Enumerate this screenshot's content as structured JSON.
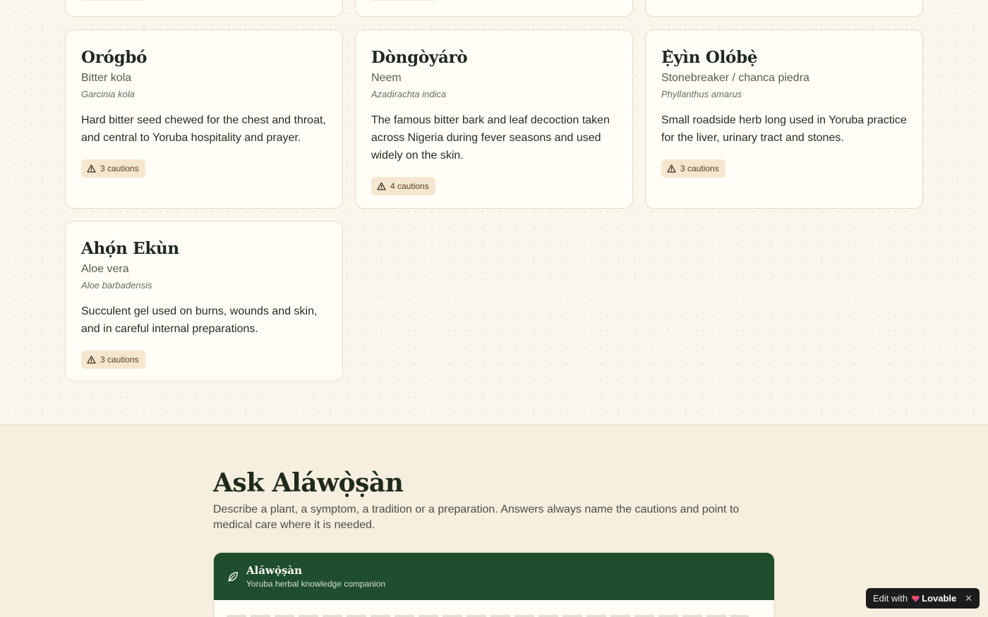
{
  "herbs": [
    {
      "name": "Orógbó",
      "common": "Bitter kola",
      "latin": "Garcinia kola",
      "description": "Hard bitter seed chewed for the chest and throat, and central to Yoruba hospitality and prayer.",
      "cautions": "3 cautions"
    },
    {
      "name": "Dòngòyárò",
      "common": "Neem",
      "latin": "Azadirachta indica",
      "description": "The famous bitter bark and leaf decoction taken across Nigeria during fever seasons and used widely on the skin.",
      "cautions": "4 cautions"
    },
    {
      "name": "Ẹ̀yìn Olóbẹ̀",
      "common": "Stonebreaker / chanca piedra",
      "latin": "Phyllanthus amarus",
      "description": "Small roadside herb long used in Yoruba practice for the liver, urinary tract and stones.",
      "cautions": "3 cautions"
    },
    {
      "name": "Ahọ́n Ekùn",
      "common": "Aloe vera",
      "latin": "Aloe barbadensis",
      "description": "Succulent gel used on burns, wounds and skin, and in careful internal preparations.",
      "cautions": "3 cautions"
    }
  ],
  "ask": {
    "title": "Ask Aláwọ̀ṣàn",
    "subtitle": "Describe a plant, a symptom, a tradition or a preparation. Answers always name the cautions and point to medical care where it is needed."
  },
  "chat": {
    "title": "Aláwọ̀ṣàn",
    "subtitle": "Yoruba herbal knowledge companion",
    "icon": "leaf-icon",
    "header_color": "#1f4d2e"
  },
  "edit_badge": {
    "label": "Edit with",
    "brand": "Lovable",
    "close": "✕"
  },
  "colors": {
    "background": "#faf6ec",
    "card": "#fffdf6",
    "caution_badge": "#f5e7cf",
    "accent_green": "#1f4d2e"
  }
}
